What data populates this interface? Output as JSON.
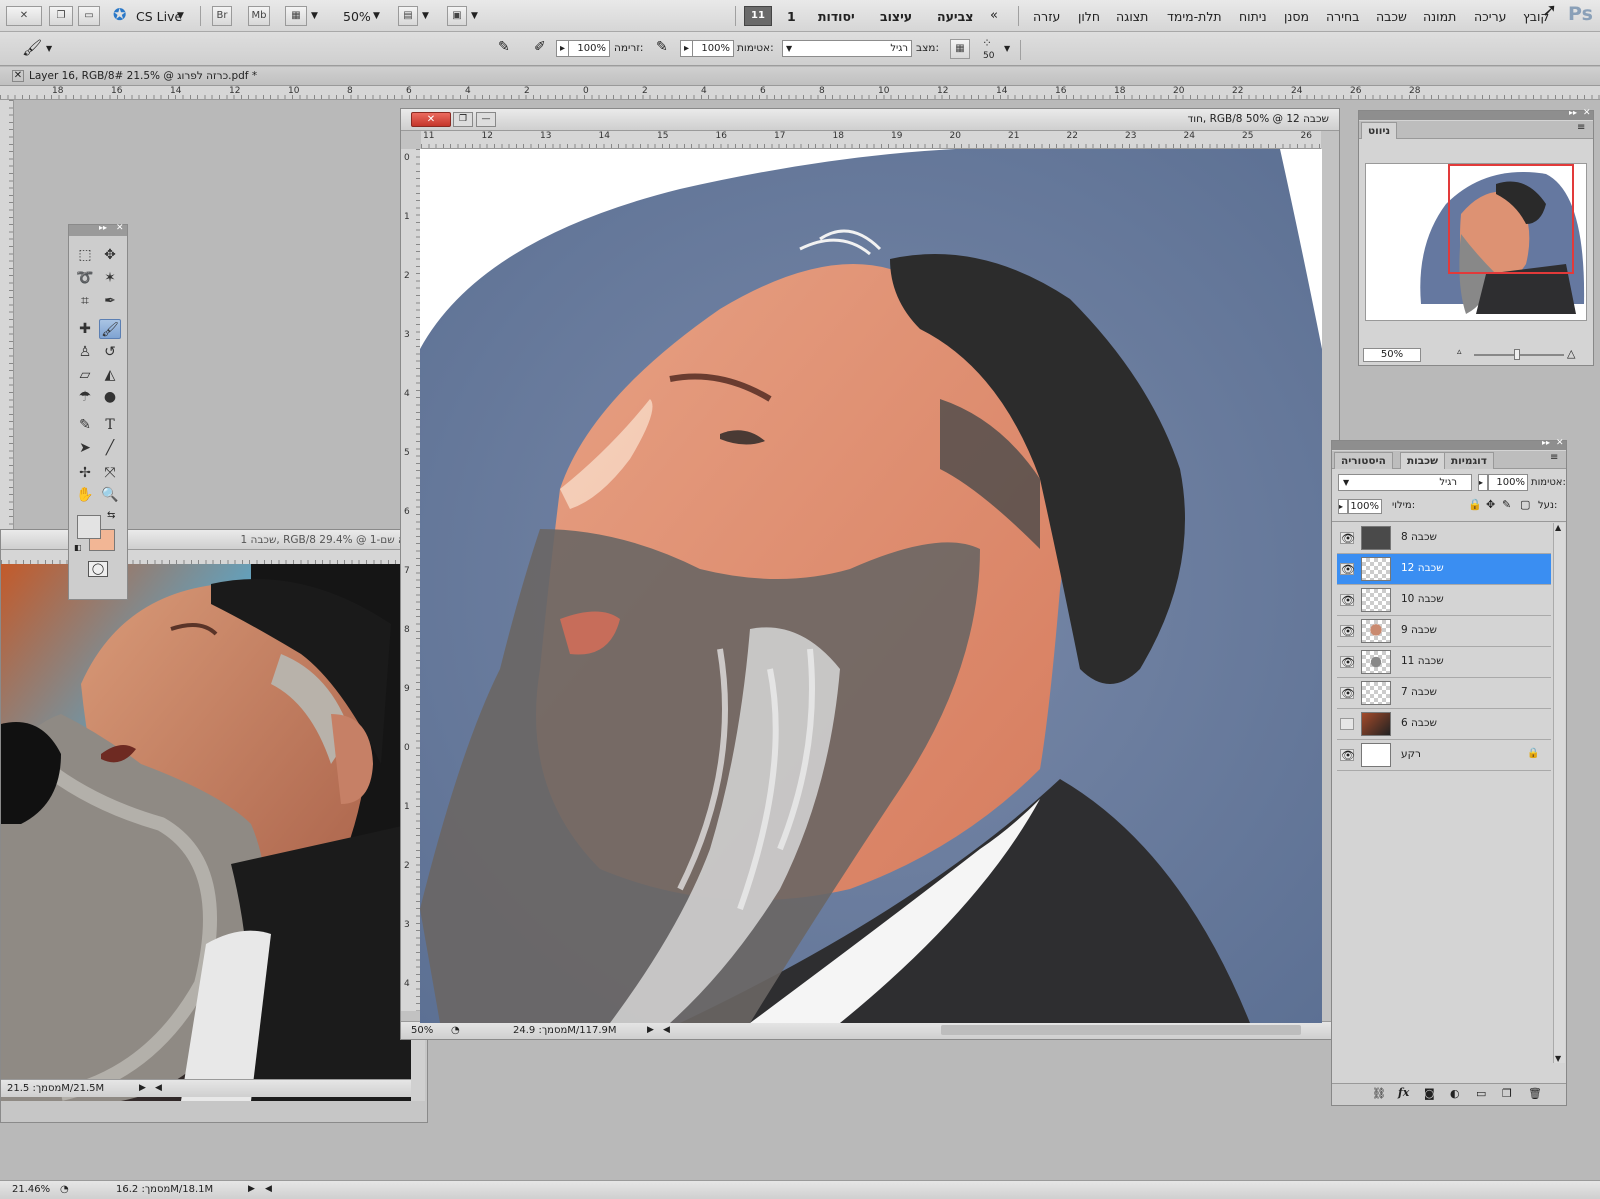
{
  "app": {
    "logo": "Ps",
    "cs_live": "CS Live",
    "zoom_menu": "50%",
    "workspace_active": "11",
    "workspace_num": "1"
  },
  "menu": {
    "items": [
      "קובץ",
      "עריכה",
      "תמונה",
      "שכבה",
      "בחירה",
      "מסנן",
      "ניתוח",
      "תלת-מימד",
      "תצוגה",
      "חלון",
      "עזרה"
    ],
    "workspaces": [
      "צביעה",
      "עיצוב",
      "יסודות"
    ],
    "bridge": "Br",
    "minibridge": "Mb"
  },
  "options": {
    "brush_size": "50",
    "mode_label": "מצב:",
    "mode_value": "רגיל",
    "opacity_label": "אטימות:",
    "opacity_value": "100%",
    "flow_label": "זרימה:",
    "flow_value": "100%"
  },
  "documents": {
    "main": {
      "title": "Layer 16, RGB/8# 21.5% @ כרזה לפרוג.pdf *",
      "zoom": "21.46%",
      "doc_size": "מסמך: 16.2M/18.1M"
    },
    "photo": {
      "title": "ללא שם-1 @ 29.4% RGB/8 ,שכבה 1",
      "doc_size": "מסמך: 21.5M/21.5M"
    },
    "painting": {
      "title": "שכבה 12 @ 50% RGB/8 ,חוד",
      "zoom": "50%",
      "doc_size": "מסמך: 24.9M/117.9M"
    }
  },
  "rulers": {
    "main_h": [
      "18",
      "16",
      "14",
      "12",
      "10",
      "8",
      "6",
      "4",
      "2",
      "0",
      "2",
      "4",
      "6",
      "8",
      "10",
      "12",
      "14",
      "16",
      "18",
      "20",
      "22",
      "24",
      "26",
      "28"
    ],
    "painting_h": [
      "11",
      "12",
      "13",
      "14",
      "15",
      "16",
      "17",
      "18",
      "19",
      "20",
      "21",
      "22",
      "23",
      "24",
      "25",
      "26"
    ],
    "painting_v": [
      "0",
      "1",
      "2",
      "3",
      "4",
      "5",
      "6",
      "7",
      "8",
      "9",
      "0",
      "1",
      "2",
      "3",
      "4"
    ]
  },
  "navigator": {
    "tab": "ניווט",
    "zoom": "50%"
  },
  "layers_panel": {
    "tabs": [
      "דוגמיות",
      "שכבות",
      "היסטוריה"
    ],
    "active_tab": "שכבות",
    "blend_mode": "רגיל",
    "opacity_label": "אטימות:",
    "opacity_value": "100%",
    "lock_label": "נעל:",
    "fill_label": "מילוי:",
    "fill_value": "100%",
    "layers": [
      {
        "name": "שכבה 8",
        "visible": true,
        "selected": false,
        "thumb": "dark"
      },
      {
        "name": "שכבה 12",
        "visible": true,
        "selected": true,
        "thumb": "trans"
      },
      {
        "name": "שכבה 10",
        "visible": true,
        "selected": false,
        "thumb": "trans"
      },
      {
        "name": "שכבה 9",
        "visible": true,
        "selected": false,
        "thumb": "face"
      },
      {
        "name": "שכבה 11",
        "visible": true,
        "selected": false,
        "thumb": "sketch"
      },
      {
        "name": "שכבה 7",
        "visible": true,
        "selected": false,
        "thumb": "trans"
      },
      {
        "name": "שכבה 6",
        "visible": false,
        "selected": false,
        "thumb": "photo"
      },
      {
        "name": "רקע",
        "visible": true,
        "selected": false,
        "thumb": "white",
        "locked": true
      }
    ],
    "footer_icons": [
      "link-icon",
      "fx-icon",
      "mask-icon",
      "adjustment-icon",
      "group-icon",
      "new-layer-icon",
      "trash-icon"
    ]
  },
  "colors": {
    "foreground": "#e3e3e3",
    "background": "#f2b695",
    "selection": "#3a8ef2",
    "close_red": "#d9443a"
  }
}
